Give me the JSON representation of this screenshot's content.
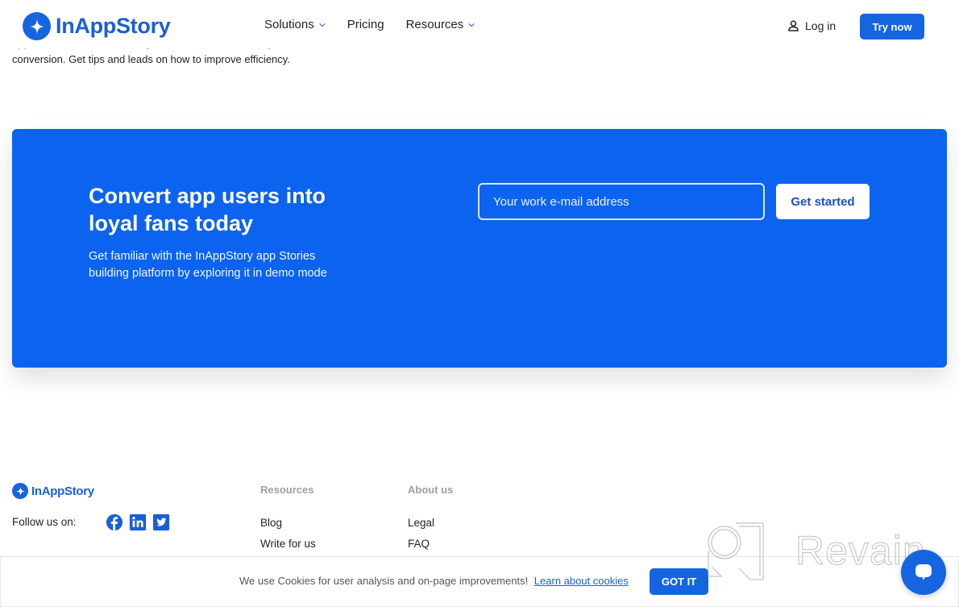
{
  "header": {
    "brand": "InAppStory",
    "nav": [
      {
        "label": "Solutions",
        "has_dropdown": true
      },
      {
        "label": "Pricing",
        "has_dropdown": false
      },
      {
        "label": "Resources",
        "has_dropdown": true
      }
    ],
    "login_label": "Log in",
    "try_label": "Try now"
  },
  "partial_text": {
    "line1": "app or mobile web based on your business needs, analyze",
    "line2": "conversion. Get tips and leads on how to improve efficiency."
  },
  "cta": {
    "title": "Convert app users into loyal fans today",
    "description": "Get familiar with the InAppStory app Stories building platform by exploring it in demo mode",
    "email_placeholder": "Your work e-mail address",
    "email_value": "",
    "button_label": "Get started",
    "accent_color": "#0b63f0"
  },
  "footer": {
    "brand": "InAppStory",
    "follow_label": "Follow us on:",
    "socials": [
      "facebook-icon",
      "linkedin-icon",
      "twitter-icon"
    ],
    "columns": [
      {
        "heading": "Resources",
        "links": [
          "Blog",
          "Write for us"
        ]
      },
      {
        "heading": "About us",
        "links": [
          "Legal",
          "FAQ"
        ]
      }
    ]
  },
  "watermark": {
    "text": "Revain"
  },
  "cookie_bar": {
    "text": "We use Cookies for user analysis and on-page improvements!",
    "link_label": "Learn about cookies",
    "button_label": "GOT IT"
  }
}
